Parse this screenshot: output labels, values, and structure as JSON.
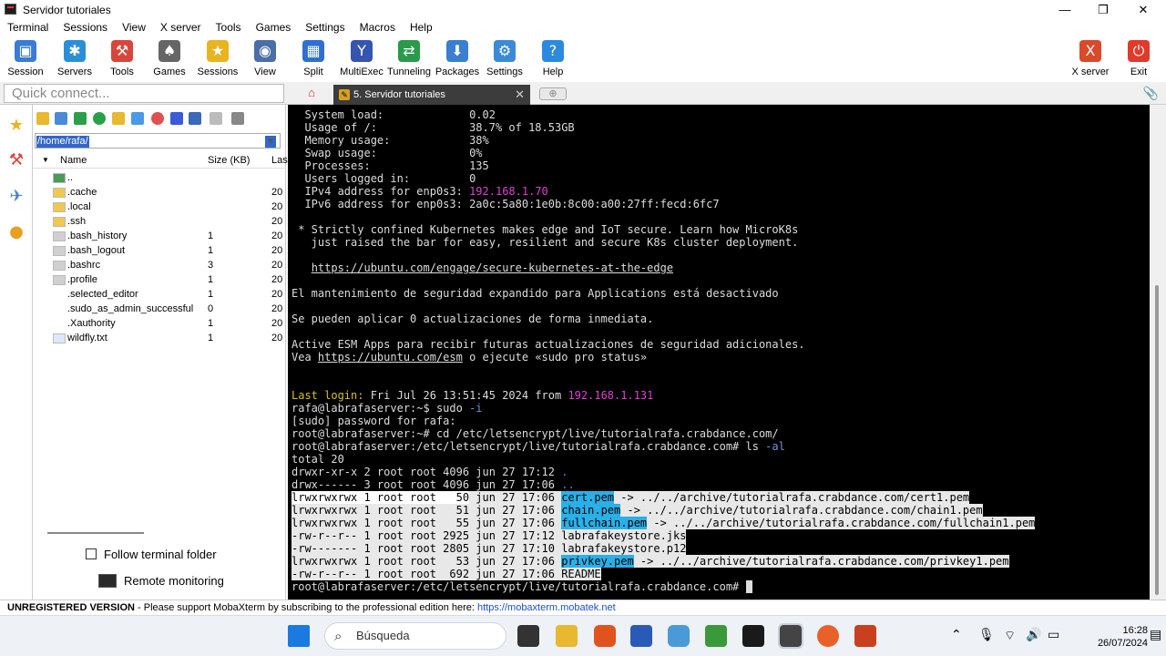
{
  "window": {
    "title": "Servidor tutoriales",
    "min": "—",
    "max": "❐",
    "close": "✕"
  },
  "menu": [
    "Terminal",
    "Sessions",
    "View",
    "X server",
    "Tools",
    "Games",
    "Settings",
    "Macros",
    "Help"
  ],
  "toolbar": [
    {
      "label": "Session",
      "icon": "session-icon",
      "color": "#3a7bd5",
      "glyph": "▣"
    },
    {
      "label": "Servers",
      "icon": "servers-icon",
      "color": "#2b8fd8",
      "glyph": "✱"
    },
    {
      "label": "Tools",
      "icon": "tools-icon",
      "color": "#d8453a",
      "glyph": "⚒"
    },
    {
      "label": "Games",
      "icon": "games-icon",
      "color": "#666666",
      "glyph": "♠"
    },
    {
      "label": "Sessions",
      "icon": "star-icon",
      "color": "#e8b420",
      "glyph": "★"
    },
    {
      "label": "View",
      "icon": "view-icon",
      "color": "#4a6fa5",
      "glyph": "◉"
    },
    {
      "label": "Split",
      "icon": "split-icon",
      "color": "#2f6fd0",
      "glyph": "▦"
    },
    {
      "label": "MultiExec",
      "icon": "multiexec-icon",
      "color": "#3555b0",
      "glyph": "Y"
    },
    {
      "label": "Tunneling",
      "icon": "tunneling-icon",
      "color": "#2a9a4a",
      "glyph": "⇄"
    },
    {
      "label": "Packages",
      "icon": "packages-icon",
      "color": "#3a7fd0",
      "glyph": "⬇"
    },
    {
      "label": "Settings",
      "icon": "settings-icon",
      "color": "#3a8ad8",
      "glyph": "⚙"
    },
    {
      "label": "Help",
      "icon": "help-icon",
      "color": "#2a8ae0",
      "glyph": "?"
    }
  ],
  "toolbar_right": [
    {
      "label": "X server",
      "icon": "xserver-icon",
      "color": "#d84a2a",
      "glyph": "X"
    },
    {
      "label": "Exit",
      "icon": "exit-icon",
      "color": "#e03a2a",
      "glyph": "⏻"
    }
  ],
  "quick_connect": {
    "placeholder": "Quick connect..."
  },
  "tab": {
    "label": "5. Servidor tutoriales",
    "close": "✕"
  },
  "sftp": {
    "path": "/home/rafa/",
    "columns": {
      "name": "Name",
      "size": "Size (KB)",
      "last": "Las"
    },
    "files": [
      {
        "name": "..",
        "size": "",
        "date": "",
        "kind": "up"
      },
      {
        "name": ".cache",
        "size": "",
        "date": "20",
        "kind": "folder"
      },
      {
        "name": ".local",
        "size": "",
        "date": "20",
        "kind": "folder"
      },
      {
        "name": ".ssh",
        "size": "",
        "date": "20",
        "kind": "folder"
      },
      {
        "name": ".bash_history",
        "size": "1",
        "date": "20",
        "kind": "hidden"
      },
      {
        "name": ".bash_logout",
        "size": "1",
        "date": "20",
        "kind": "hidden"
      },
      {
        "name": ".bashrc",
        "size": "3",
        "date": "20",
        "kind": "hidden"
      },
      {
        "name": ".profile",
        "size": "1",
        "date": "20",
        "kind": "hidden"
      },
      {
        "name": ".selected_editor",
        "size": "1",
        "date": "20",
        "kind": "blank"
      },
      {
        "name": ".sudo_as_admin_successful",
        "size": "0",
        "date": "20",
        "kind": "blank"
      },
      {
        "name": ".Xauthority",
        "size": "1",
        "date": "20",
        "kind": "blank"
      },
      {
        "name": "wildfly.txt",
        "size": "1",
        "date": "20",
        "kind": "text"
      }
    ],
    "follow_label": "Follow terminal folder",
    "remote_label": "Remote monitoring"
  },
  "terminal": {
    "lines": [
      [
        {
          "t": "  System load:             0.02"
        }
      ],
      [
        {
          "t": "  Usage of /:              38.7% of 18.53GB"
        }
      ],
      [
        {
          "t": "  Memory usage:            38%"
        }
      ],
      [
        {
          "t": "  Swap usage:              0%"
        }
      ],
      [
        {
          "t": "  Processes:               135"
        }
      ],
      [
        {
          "t": "  Users logged in:         0"
        }
      ],
      [
        {
          "t": "  IPv4 address for enp0s3: "
        },
        {
          "t": "192.168.1.70",
          "c": "#e040d0"
        }
      ],
      [
        {
          "t": "  IPv6 address for enp0s3: 2a0c:5a80:1e0b:8c00:a00:27ff:fecd:6fc7"
        }
      ],
      [
        {
          "t": ""
        }
      ],
      [
        {
          "t": " * Strictly confined Kubernetes makes edge and IoT secure. Learn how MicroK8s"
        }
      ],
      [
        {
          "t": "   just raised the bar for easy, resilient and secure K8s cluster deployment."
        }
      ],
      [
        {
          "t": ""
        }
      ],
      [
        {
          "t": "   "
        },
        {
          "t": "https://ubuntu.com/engage/secure-kubernetes-at-the-edge",
          "u": true
        }
      ],
      [
        {
          "t": ""
        }
      ],
      [
        {
          "t": "El mantenimiento de seguridad expandido para Applications está desactivado"
        }
      ],
      [
        {
          "t": ""
        }
      ],
      [
        {
          "t": "Se pueden aplicar 0 actualizaciones de forma inmediata."
        }
      ],
      [
        {
          "t": ""
        }
      ],
      [
        {
          "t": "Active ESM Apps para recibir futuras actualizaciones de seguridad adicionales."
        }
      ],
      [
        {
          "t": "Vea "
        },
        {
          "t": "https://ubuntu.com/esm",
          "u": true
        },
        {
          "t": " o ejecute «sudo pro status»"
        }
      ],
      [
        {
          "t": ""
        }
      ],
      [
        {
          "t": ""
        }
      ],
      [
        {
          "t": "Last login:",
          "c": "#d8c020"
        },
        {
          "t": " Fri Jul 26 13:51:45 2024 from "
        },
        {
          "t": "192.168.1.131",
          "c": "#e040d0"
        }
      ],
      [
        {
          "t": "rafa@labrafaserver:~$ sudo "
        },
        {
          "t": "-i",
          "c": "#7a8fd8"
        }
      ],
      [
        {
          "t": "[sudo] password for rafa:"
        }
      ],
      [
        {
          "t": "root@labrafaserver:~# cd /etc/letsencrypt/live/tutorialrafa.crabdance.com/"
        }
      ],
      [
        {
          "t": "root@labrafaserver:/etc/letsencrypt/live/tutorialrafa.crabdance.com# ls "
        },
        {
          "t": "-al",
          "c": "#7a8fd8"
        }
      ],
      [
        {
          "t": "total 20"
        }
      ],
      [
        {
          "t": "drwxr-xr-x 2 root root 4096 jun 27 17:12 "
        },
        {
          "t": ".",
          "c": "#4a8ad8"
        }
      ],
      [
        {
          "t": "drwx------ 3 root root 4096 jun 27 17:06 "
        },
        {
          "t": "..",
          "c": "#4a8ad8"
        }
      ],
      [
        {
          "t": "lrwxrwxrwx 1 root root   50",
          "sel": "dark"
        },
        {
          "t": " jun 27 17:06 ",
          "sel": true
        },
        {
          "t": "cert.pem",
          "sel": true,
          "hl": true
        },
        {
          "t": " -> ../../archive/tutorialrafa.crabdance.com/cert1.pem",
          "sel": true
        }
      ],
      [
        {
          "t": "lrwxrwxrwx 1 root root   51 jun 27 17:06 ",
          "sel": true
        },
        {
          "t": "chain.pem",
          "sel": true,
          "hl": true
        },
        {
          "t": " -> ../../archive/tutorialrafa.crabdance.com/chain1.pem",
          "sel": true
        }
      ],
      [
        {
          "t": "lrwxrwxrwx 1 root root   55 jun 27 17:06 ",
          "sel": true
        },
        {
          "t": "fullchain.pem",
          "sel": true,
          "hl": true
        },
        {
          "t": " -> ../../archive/tutorialrafa.crabdance.com/fullchain1.pem",
          "sel": true
        }
      ],
      [
        {
          "t": "-rw-r--r-- 1 root root 2925 jun 27 17:12 labrafakeystore.jks",
          "sel": true
        }
      ],
      [
        {
          "t": "-rw------- 1 root root 2805 jun 27 17:10 labrafakeystore.p12",
          "sel": true
        }
      ],
      [
        {
          "t": "lrwxrwxrwx 1 root root   53 jun 27 17:06 ",
          "sel": true
        },
        {
          "t": "privkey.pem",
          "sel": true,
          "hl": true
        },
        {
          "t": " -> ../../archive/tutorialrafa.crabdance.com/privkey1.pem",
          "sel": true
        }
      ],
      [
        {
          "t": "-rw-r--r-- 1 root root  692 jun 27 17:06 README",
          "sel": true
        }
      ],
      [
        {
          "t": "root@labrafaserver:/etc/letsencrypt/live/tutorialrafa.crabdance.com# "
        },
        {
          "t": " ",
          "cursor": true
        }
      ]
    ]
  },
  "status": {
    "unregistered": "UNREGISTERED VERSION",
    "message": "  -  Please support MobaXterm by subscribing to the professional edition here:  ",
    "link": "https://mobaxterm.mobatek.net"
  },
  "taskbar": {
    "search_placeholder": "Búsqueda",
    "time": "16:28",
    "date": "26/07/2024"
  }
}
